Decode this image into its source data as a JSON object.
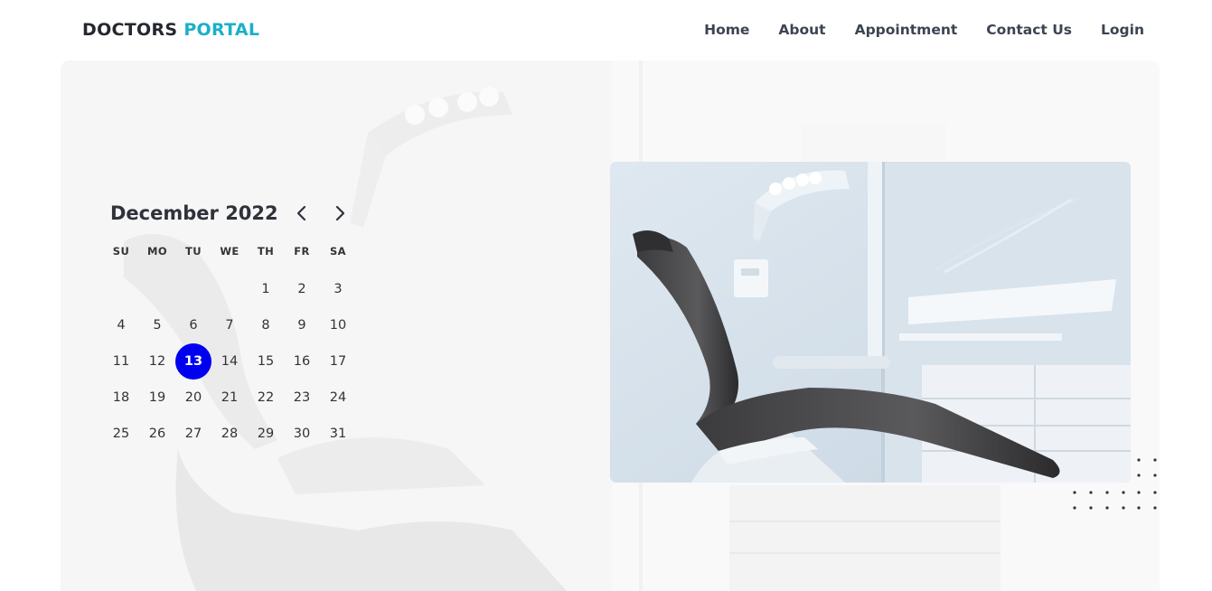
{
  "brand": {
    "part1": "DOCTORS",
    "part2": "PORTAL",
    "accent": "#1bb0c8"
  },
  "nav": {
    "items": [
      {
        "label": "Home"
      },
      {
        "label": "About"
      },
      {
        "label": "Appointment"
      },
      {
        "label": "Contact Us"
      },
      {
        "label": "Login"
      }
    ]
  },
  "calendar": {
    "month_label": "December 2022",
    "prev_icon": "chevron-left-icon",
    "next_icon": "chevron-right-icon",
    "weekdays": [
      "SU",
      "MO",
      "TU",
      "WE",
      "TH",
      "FR",
      "SA"
    ],
    "weeks": [
      [
        "",
        "",
        "",
        "",
        "1",
        "2",
        "3"
      ],
      [
        "4",
        "5",
        "6",
        "7",
        "8",
        "9",
        "10"
      ],
      [
        "11",
        "12",
        "13",
        "14",
        "15",
        "16",
        "17"
      ],
      [
        "18",
        "19",
        "20",
        "21",
        "22",
        "23",
        "24"
      ],
      [
        "25",
        "26",
        "27",
        "28",
        "29",
        "30",
        "31"
      ]
    ],
    "selected_day": "13",
    "selected_color": "#0000f0"
  },
  "hero": {
    "image": "dental-chair-photo"
  }
}
